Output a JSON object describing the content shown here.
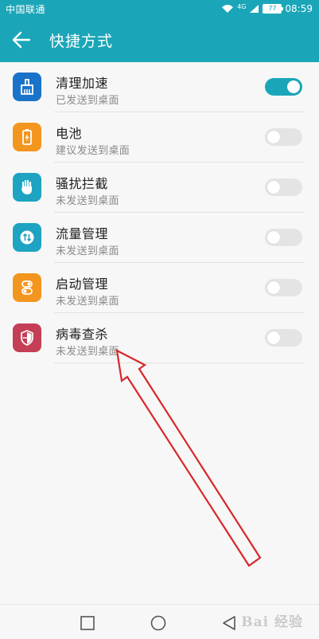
{
  "status_bar": {
    "carrier": "中国联通",
    "network": "4G",
    "battery": "77",
    "time": "08:59"
  },
  "header": {
    "title": "快捷方式",
    "back_icon": "arrow-left-icon"
  },
  "shortcuts": [
    {
      "title": "清理加速",
      "status": "已发送到桌面",
      "enabled": true,
      "icon": "broom-icon",
      "icon_color": "#1a73c9"
    },
    {
      "title": "电池",
      "status": "建议发送到桌面",
      "enabled": false,
      "icon": "battery-icon",
      "icon_color": "#f3961f"
    },
    {
      "title": "骚扰拦截",
      "status": "未发送到桌面",
      "enabled": false,
      "icon": "hand-icon",
      "icon_color": "#1ea3c2"
    },
    {
      "title": "流量管理",
      "status": "未发送到桌面",
      "enabled": false,
      "icon": "data-traffic-icon",
      "icon_color": "#1ea3c2"
    },
    {
      "title": "启动管理",
      "status": "未发送到桌面",
      "enabled": false,
      "icon": "startup-switch-icon",
      "icon_color": "#f3961f"
    },
    {
      "title": "病毒查杀",
      "status": "未发送到桌面",
      "enabled": false,
      "icon": "shield-icon",
      "icon_color": "#c43f55"
    }
  ],
  "nav_bar": {
    "recents_icon": "square-icon",
    "home_icon": "circle-icon",
    "back_icon": "triangle-back-icon"
  },
  "watermark": "Bai 经验",
  "colors": {
    "accent": "#1aa6b8",
    "annotation_arrow": "#d9262b"
  }
}
